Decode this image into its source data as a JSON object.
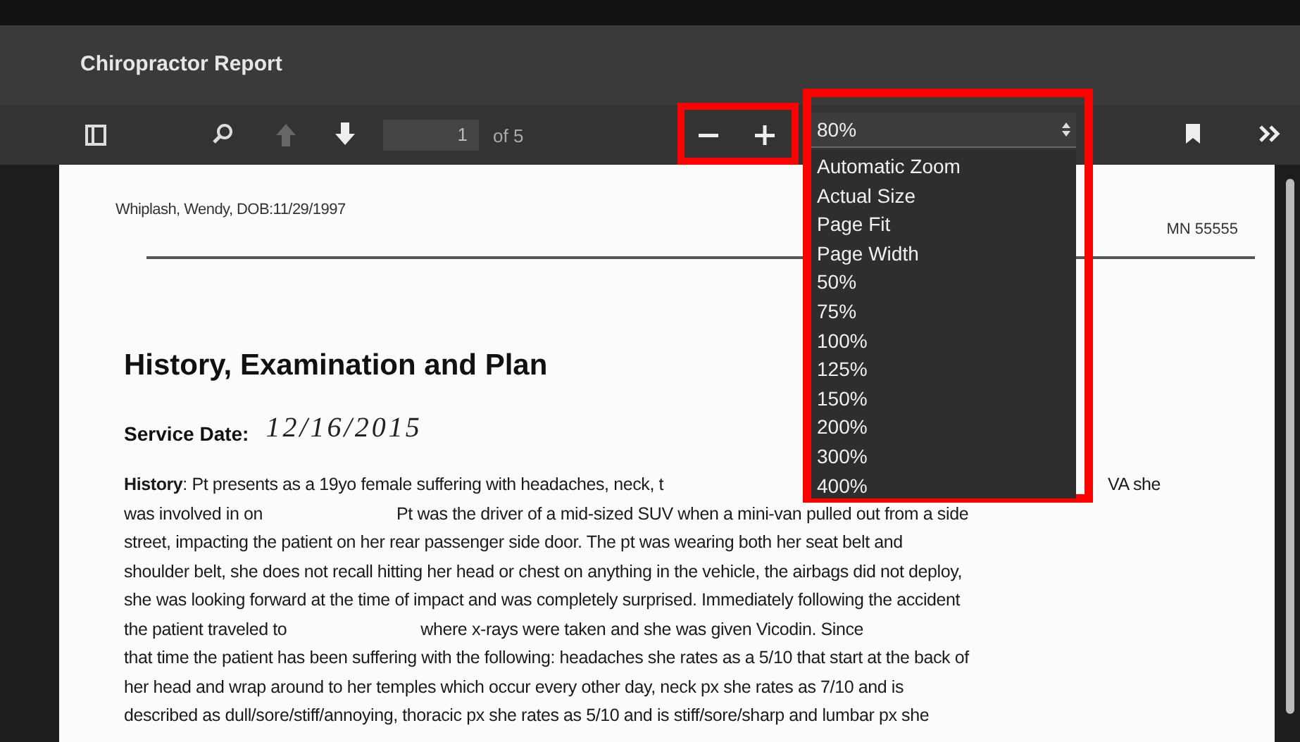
{
  "window": {
    "title": "Chiropractor Report"
  },
  "toolbar": {
    "page": "1",
    "page_count": "of 5",
    "zoom_value": "80%",
    "previous_disabled": true
  },
  "zoom_menu": {
    "options": [
      "Automatic Zoom",
      "Actual Size",
      "Page Fit",
      "Page Width",
      "50%",
      "75%",
      "100%",
      "125%",
      "150%",
      "200%",
      "300%",
      "400%"
    ]
  },
  "document": {
    "header": "Whiplash, Wendy, DOB:11/29/1997",
    "address_fragment": "MN 55555",
    "heading": "History, Examination and Plan",
    "service_date_label": "Service Date:",
    "service_date": "12/16/2015",
    "lines": [
      {
        "kind": "covered",
        "segments": [
          "**History**: Pt presents as a 19yo female suffering with headaches, neck, t",
          "VA she"
        ]
      },
      {
        "kind": "redacted",
        "segments": [
          "was involved in on",
          "Pt was the driver of a mid-sized SUV when a mini-van pulled out from a side"
        ]
      },
      {
        "kind": "plain",
        "segments": [
          "street, impacting the patient on her rear passenger side door. The pt was wearing both her seat belt and"
        ]
      },
      {
        "kind": "plain",
        "segments": [
          "shoulder belt, she does not recall hitting her head or chest on anything in the vehicle, the airbags did not deploy,"
        ]
      },
      {
        "kind": "plain",
        "segments": [
          "she was looking forward at the time of impact and was completely surprised. Immediately following the accident"
        ]
      },
      {
        "kind": "redacted",
        "segments": [
          "the patient traveled to",
          "where x-rays were taken and she was given Vicodin. Since"
        ]
      },
      {
        "kind": "plain",
        "segments": [
          "that time the patient has been suffering with the following: headaches she rates as a 5/10 that start at the back of"
        ]
      },
      {
        "kind": "plain",
        "segments": [
          "her head and wrap around to her temples which occur every other day, neck px she rates as 7/10 and is"
        ]
      },
      {
        "kind": "plain",
        "segments": [
          "described as dull/sore/stiff/annoying, thoracic px she rates as 5/10 and is stiff/sore/sharp and lumbar px she"
        ]
      }
    ]
  }
}
